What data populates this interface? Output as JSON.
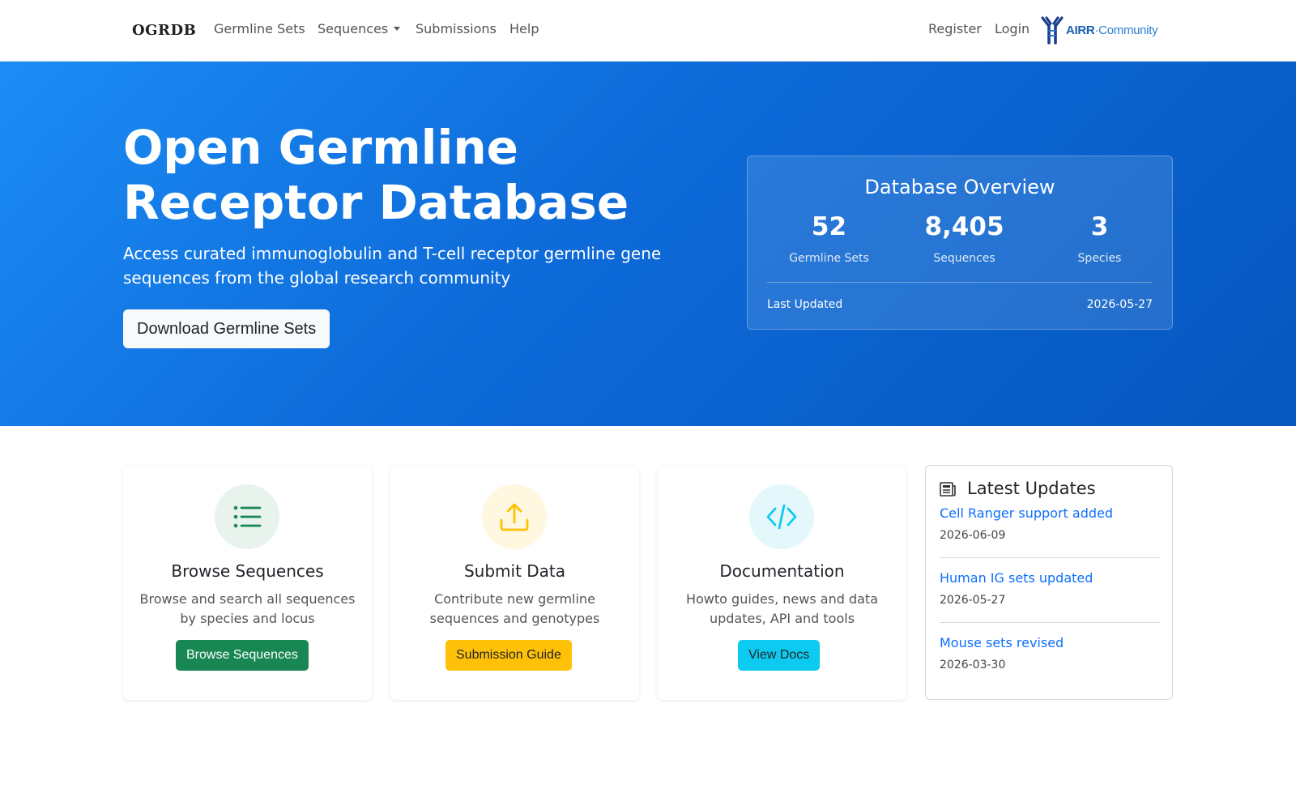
{
  "nav": {
    "brand": "OGRDB",
    "links": [
      {
        "label": "Germline Sets"
      },
      {
        "label": "Sequences"
      },
      {
        "label": "Submissions"
      },
      {
        "label": "Help"
      }
    ],
    "register": "Register",
    "login": "Login",
    "logo": {
      "airr": "AIRR",
      "community": "Community",
      "color": "#1a5fb4"
    }
  },
  "hero": {
    "title_line1": "Open Germline",
    "title_line2": "Receptor Database",
    "subtitle": "Access curated immunoglobulin and T-cell receptor germline gene sequences from the global research community",
    "button": "Download Germline Sets",
    "gradient_colors": [
      "#1c8cf5",
      "#0657bf"
    ]
  },
  "overview": {
    "title": "Database Overview",
    "stats": [
      {
        "value": "52",
        "label": "Germline Sets"
      },
      {
        "value": "8,405",
        "label": "Sequences"
      },
      {
        "value": "3",
        "label": "Species"
      }
    ],
    "last_updated_label": "Last Updated",
    "last_updated_value": "2026-05-27"
  },
  "cards": [
    {
      "icon": "list-icon",
      "title": "Browse Sequences",
      "text": "Browse and search all sequences by species and locus",
      "button": "Browse Sequences",
      "color": "#198754"
    },
    {
      "icon": "upload-icon",
      "title": "Submit Data",
      "text": "Contribute new germline sequences and genotypes",
      "button": "Submission Guide",
      "color": "#ffc107"
    },
    {
      "icon": "code-icon",
      "title": "Documentation",
      "text": "Howto guides, news and data updates, API and tools",
      "button": "View Docs",
      "color": "#0dcaf0"
    }
  ],
  "updates": {
    "icon": "newspaper-icon",
    "title": "Latest Updates",
    "items": [
      {
        "title": "Cell Ranger support added",
        "date": "2026-06-09"
      },
      {
        "title": "Human IG sets updated",
        "date": "2026-05-27"
      },
      {
        "title": "Mouse sets revised",
        "date": "2026-03-30"
      }
    ]
  }
}
